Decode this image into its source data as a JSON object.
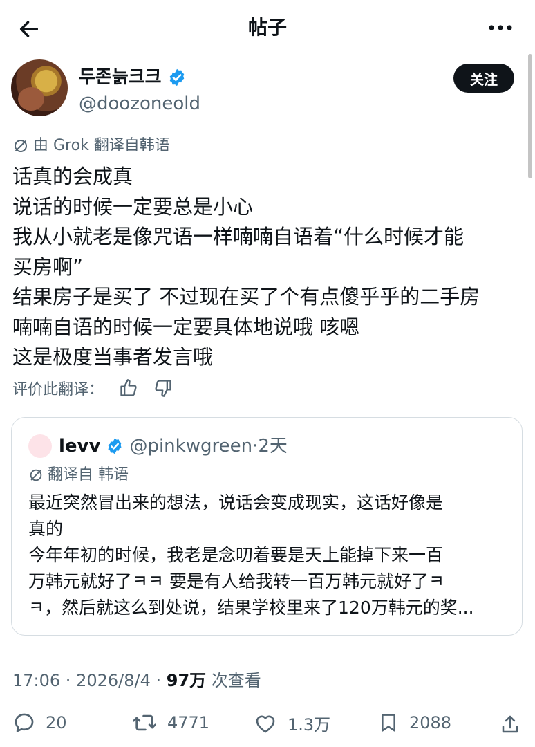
{
  "header": {
    "title": "帖子",
    "back_icon": "arrow-left-icon",
    "more_icon": "more-horizontal-icon"
  },
  "author": {
    "name": "두존늙크크",
    "handle": "@doozoneold",
    "verified": true,
    "follow_label": "关注"
  },
  "post": {
    "translation_note": "由 Grok 翻译自韩语",
    "lines": [
      "话真的会成真",
      "说话的时候一定要总是小心",
      "我从小就老是像咒语一样喃喃自语着“什么时候才能",
      "买房啊”",
      "结果房子是买了 不过现在买了个有点傻乎乎的二手房",
      "喃喃自语的时候一定要具体地说哦 咳嗯",
      "这是极度当事者发言哦"
    ],
    "rate_translation_label": "评价此翻译："
  },
  "quote": {
    "name": "levv",
    "handle": "@pinkwgreen",
    "dot": "·",
    "time": "2天",
    "translation_note": "翻译自 韩语",
    "lines": [
      "最近突然冒出来的想法，说话会变成现实，这话好像是",
      "真的",
      "今年年初的时候，我老是念叨着要是天上能掉下来一百",
      "万韩元就好了ㅋㅋ 要是有人给我转一百万韩元就好了ㅋ",
      "ㅋ，然后就这么到处说，结果学校里来了120万韩元的奖..."
    ]
  },
  "meta": {
    "time": "17:06",
    "sep1": " · ",
    "date": "2026/8/4",
    "sep2": " · ",
    "views": "97万",
    "views_label": " 次查看"
  },
  "actions": {
    "replies": "20",
    "reposts": "4771",
    "likes": "1.3万",
    "bookmarks": "2088"
  },
  "colors": {
    "text": "#0f1419",
    "secondary": "#536471",
    "verified_blue": "#1d9bf0",
    "border": "#d6dde2"
  }
}
